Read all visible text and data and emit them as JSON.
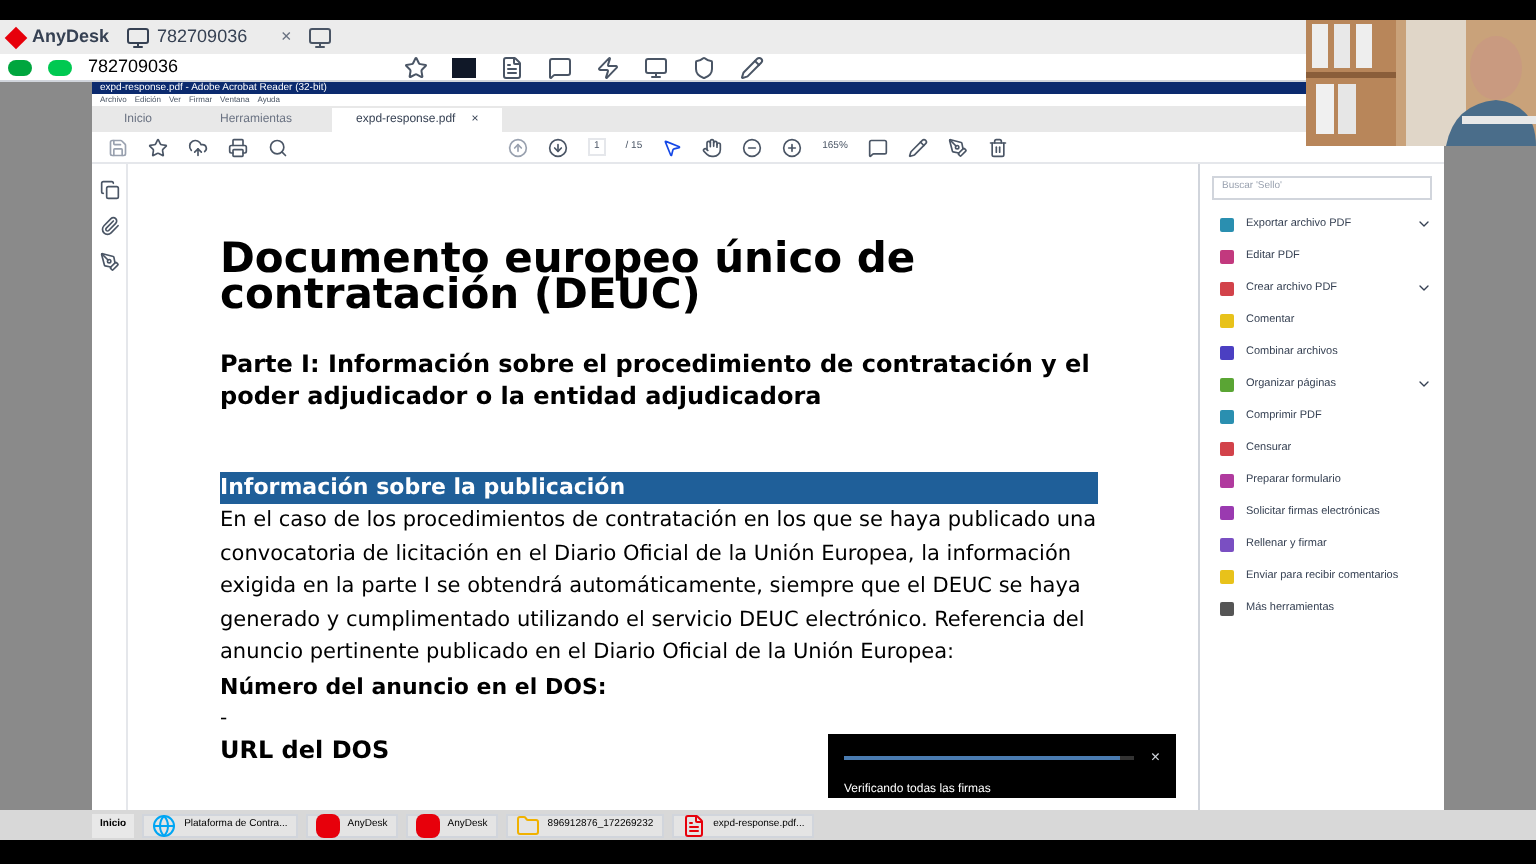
{
  "anydesk": {
    "app_name": "AnyDesk",
    "tab": {
      "label": "782709036",
      "close": "×"
    },
    "address": "782709036"
  },
  "acrobat": {
    "title": "expd-response.pdf - Adobe Acrobat Reader (32-bit)",
    "menu": [
      "Archivo",
      "Edición",
      "Ver",
      "Firmar",
      "Ventana",
      "Ayuda"
    ],
    "tabs": [
      {
        "label": "Inicio",
        "selected": false
      },
      {
        "label": "Herramientas",
        "selected": false
      },
      {
        "label": "expd-response.pdf",
        "selected": true,
        "close": "×"
      }
    ],
    "page": {
      "current": "1",
      "total": "/ 15"
    },
    "zoom": "165%"
  },
  "document": {
    "title": "Documento europeo único de contratación (DEUC)",
    "part": "Parte I: Información sobre el procedimiento de contratación y el poder adjudicador o la entidad adjudicadora",
    "section": "Información sobre la publicación",
    "paragraph": "En el caso de los procedimientos de contratación en los que se haya publicado una convocatoria de licitación en el Diario Oficial de la Unión Europea, la información exigida en la parte I se obtendrá automáticamente, siempre que el DEUC se haya generado y cumplimentado utilizando el servicio DEUC electrónico. Referencia del anuncio pertinente publicado en el Diario Oficial de la Unión Europea:",
    "field_label": "Número del anuncio en el DOS:",
    "field_value": "-",
    "url_label": "URL del DOS"
  },
  "tools_panel": {
    "search": {
      "placeholder": "Buscar 'Sello'"
    },
    "items": [
      {
        "label": "Exportar archivo PDF",
        "expandable": true,
        "color": "#2a8fb0"
      },
      {
        "label": "Editar PDF",
        "expandable": false,
        "color": "#c2397e"
      },
      {
        "label": "Crear archivo PDF",
        "expandable": true,
        "color": "#d2424a"
      },
      {
        "label": "Comentar",
        "expandable": false,
        "color": "#e8c21a"
      },
      {
        "label": "Combinar archivos",
        "expandable": false,
        "color": "#4b3fc2"
      },
      {
        "label": "Organizar páginas",
        "expandable": true,
        "color": "#5aa534"
      },
      {
        "label": "Comprimir PDF",
        "expandable": false,
        "color": "#2a8fb0"
      },
      {
        "label": "Censurar",
        "expandable": false,
        "color": "#d2424a"
      },
      {
        "label": "Preparar formulario",
        "expandable": false,
        "color": "#b03a9e"
      },
      {
        "label": "Solicitar firmas electrónicas",
        "expandable": false,
        "color": "#9a3ab0"
      },
      {
        "label": "Rellenar y firmar",
        "expandable": false,
        "color": "#7a4fc2"
      },
      {
        "label": "Enviar para recibir comentarios",
        "expandable": false,
        "color": "#e8c21a"
      },
      {
        "label": "Más herramientas",
        "expandable": false,
        "color": "#555555"
      }
    ]
  },
  "toast": {
    "message": "Verificando todas las firmas",
    "level": 0.95,
    "close": "×"
  },
  "taskbar": [
    {
      "label": "Inicio",
      "kind": "start"
    },
    {
      "label": "Plataforma de Contra...",
      "kind": "browser"
    },
    {
      "label": "AnyDesk",
      "kind": "anydesk"
    },
    {
      "label": "AnyDesk",
      "kind": "anydesk"
    },
    {
      "label": "896912876_172269232",
      "kind": "folder"
    },
    {
      "label": "expd-response.pdf...",
      "kind": "pdf"
    }
  ]
}
